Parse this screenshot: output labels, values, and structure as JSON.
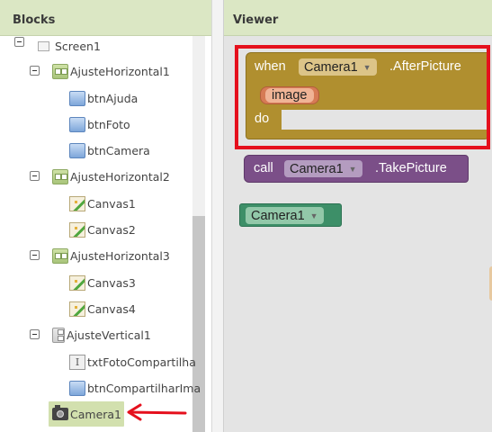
{
  "blocks_panel": {
    "title": "Blocks",
    "tree": {
      "screen": "Screen1",
      "items": [
        {
          "label": "AjusteHorizontal1"
        },
        {
          "label": "btnAjuda"
        },
        {
          "label": "btnFoto"
        },
        {
          "label": "btnCamera"
        },
        {
          "label": "AjusteHorizontal2"
        },
        {
          "label": "Canvas1"
        },
        {
          "label": "Canvas2"
        },
        {
          "label": "AjusteHorizontal3"
        },
        {
          "label": "Canvas3"
        },
        {
          "label": "Canvas4"
        },
        {
          "label": "AjusteVertical1"
        },
        {
          "label": "txtFotoCompartilha"
        },
        {
          "label": "btnCompartilharIma"
        },
        {
          "label": "Camera1"
        }
      ]
    }
  },
  "viewer": {
    "title": "Viewer",
    "event_block": {
      "when": "when",
      "component": "Camera1",
      "event": ".AfterPicture",
      "param": "image",
      "do": "do"
    },
    "call_block": {
      "call": "call",
      "component": "Camera1",
      "method": ".TakePicture"
    },
    "component_block": {
      "component": "Camera1"
    }
  },
  "colors": {
    "event_block": "#b08f2f",
    "call_block": "#7b4f88",
    "component_block": "#3d8f68",
    "highlight": "#e5101d",
    "panel_header": "#dbe7c4"
  }
}
